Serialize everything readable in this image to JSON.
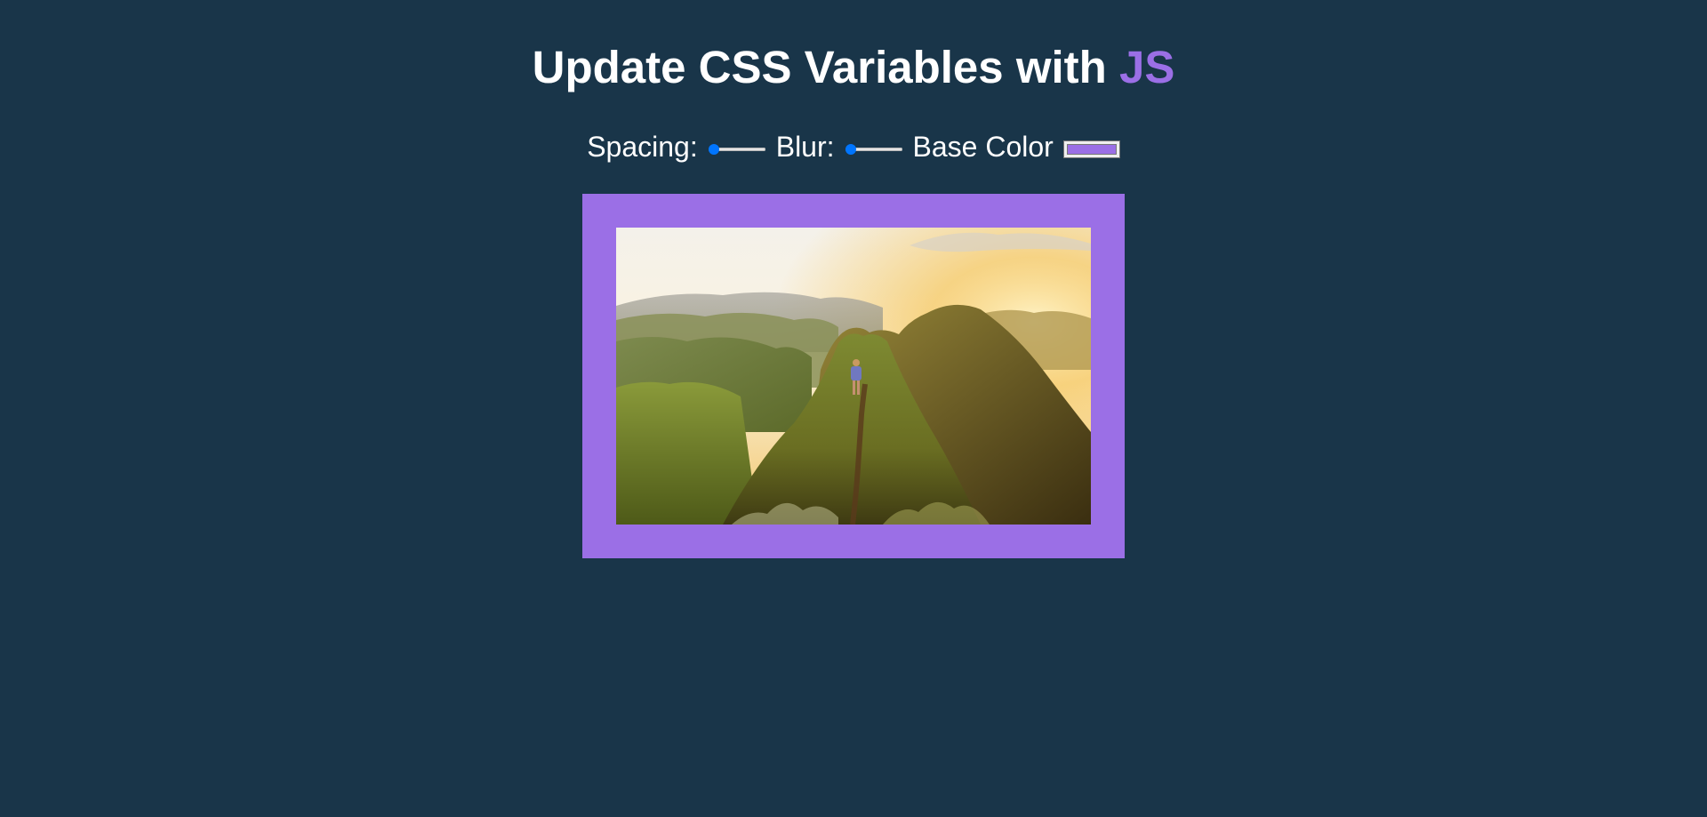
{
  "header": {
    "title_prefix": "Update CSS Variables with ",
    "title_highlight": "JS"
  },
  "controls": {
    "spacing_label": "Spacing:",
    "spacing": {
      "min": 10,
      "max": 200,
      "value": 30
    },
    "blur_label": "Blur:",
    "blur": {
      "min": 0,
      "max": 25,
      "value": 0
    },
    "base_label": "Base Color"
  },
  "theme": {
    "background": "#193549",
    "base_color": "#9b6fe6",
    "slider_accent": "#0075ff"
  },
  "image": {
    "subject": "hiker on grassy mountain ridge at sunrise"
  }
}
